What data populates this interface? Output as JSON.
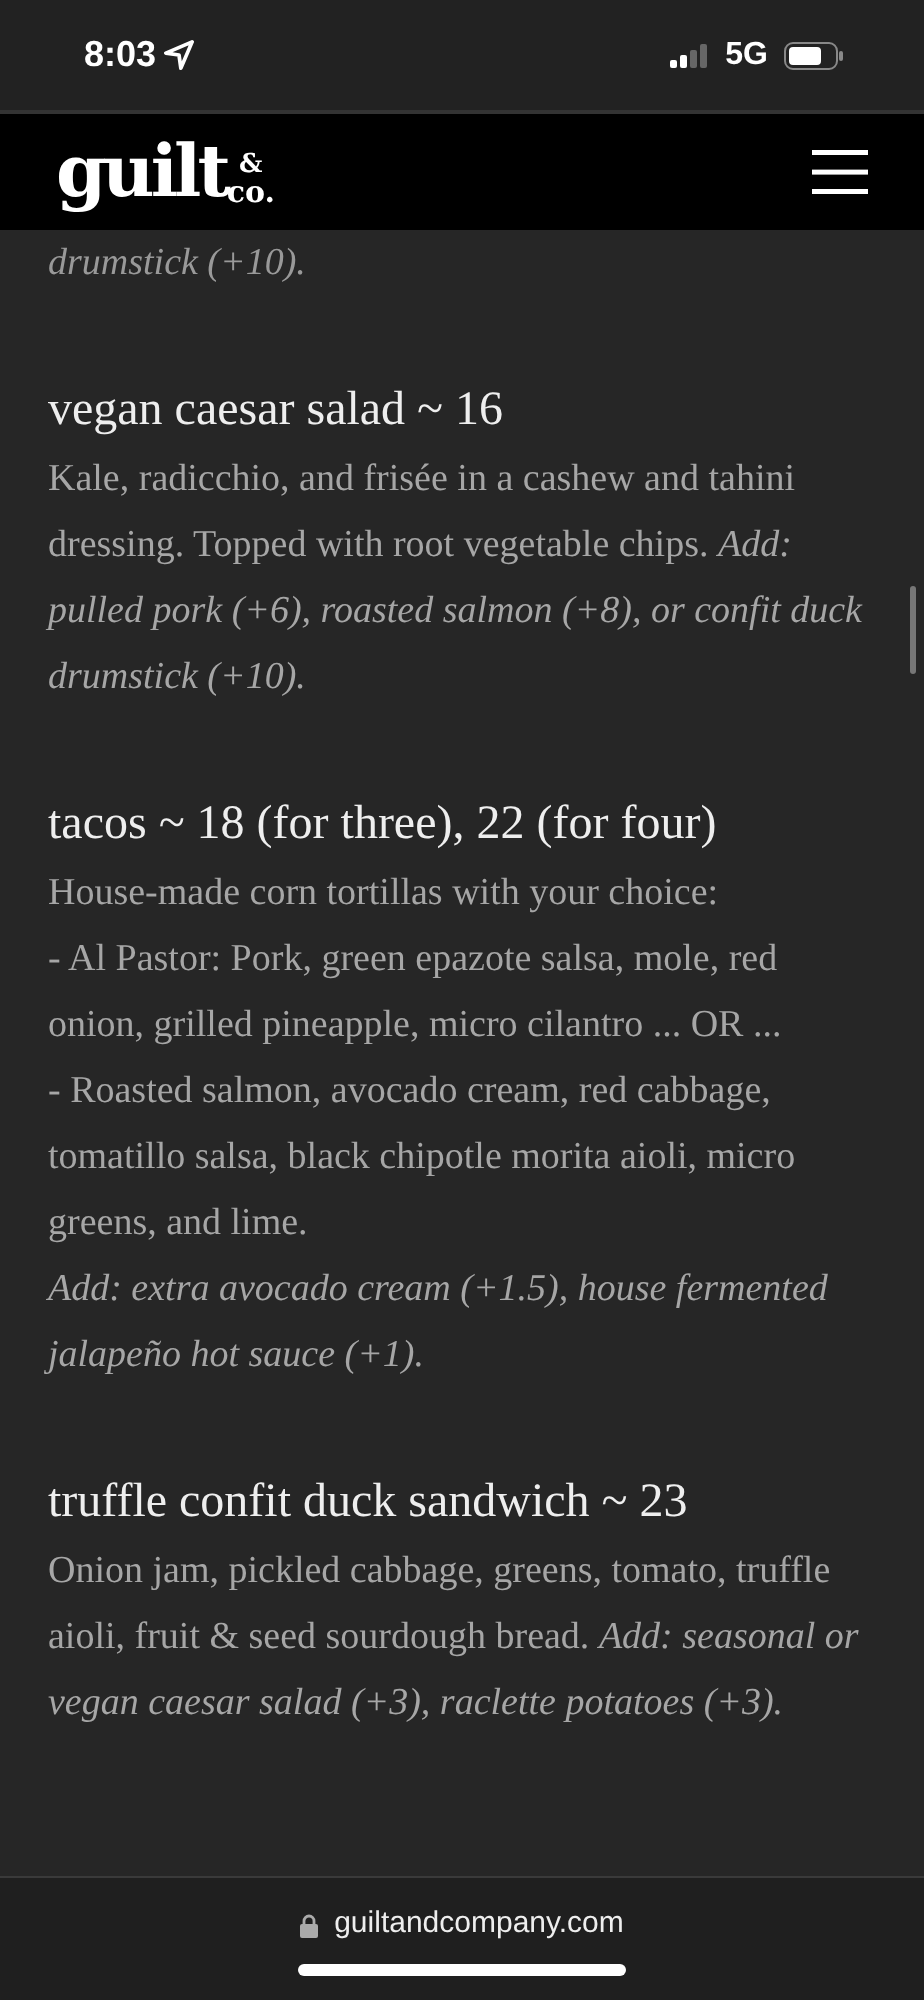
{
  "status_bar": {
    "time": "8:03",
    "network": "5G"
  },
  "header": {
    "logo": {
      "main": "guilt",
      "amp": "&",
      "rest": "co."
    }
  },
  "menu": {
    "top_fragment": "drumstick (+10).",
    "items": [
      {
        "title": "vegan caesar salad ~ 16",
        "paragraphs": [
          "Kale, radicchio, and frisée in a cashew and tahini dressing. Topped with root vegetable chips. *Add: pulled pork (+6), roasted salmon (+8), or confit duck drumstick (+10).*"
        ]
      },
      {
        "title": "tacos ~ 18 (for three), 22 (for four)",
        "paragraphs": [
          "House-made corn tortillas with your choice:",
          "- Al Pastor: Pork, green epazote salsa, mole, red onion, grilled pineapple, micro cilantro ... OR ...",
          "- Roasted salmon, avocado cream, red cabbage, tomatillo salsa, black chipotle morita aioli, micro greens, and lime.",
          "*Add: extra avocado cream (+1.5), house fermented jalapeño hot sauce (+1).*"
        ]
      },
      {
        "title": "truffle confit duck sandwich ~ 23",
        "paragraphs": [
          "Onion jam, pickled cabbage, greens, tomato, truffle aioli, fruit & seed sourdough bread. *Add: seasonal or vegan caesar salad (+3), raclette potatoes (+3).*"
        ]
      }
    ]
  },
  "browser_bar": {
    "url": "guiltandcompany.com"
  }
}
